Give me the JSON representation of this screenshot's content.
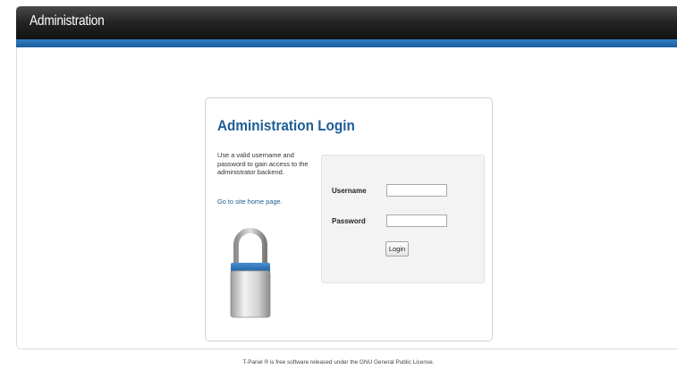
{
  "header": {
    "title": "Administration"
  },
  "login": {
    "title": "Administration Login",
    "description": "Use a valid username and password to gain access to the administrator backend.",
    "home_link": "Go to site home page.",
    "lock_icon": "padlock-icon"
  },
  "form": {
    "username_label": "Username",
    "username_value": "",
    "password_label": "Password",
    "password_value": "",
    "login_label": "Login"
  },
  "footer": {
    "text": "T-Panel ® is free software released under the GNU General Public License."
  },
  "colors": {
    "header_dark": "#1a1a1a",
    "header_stripe": "#2670b5",
    "title_blue": "#1d5d95"
  }
}
